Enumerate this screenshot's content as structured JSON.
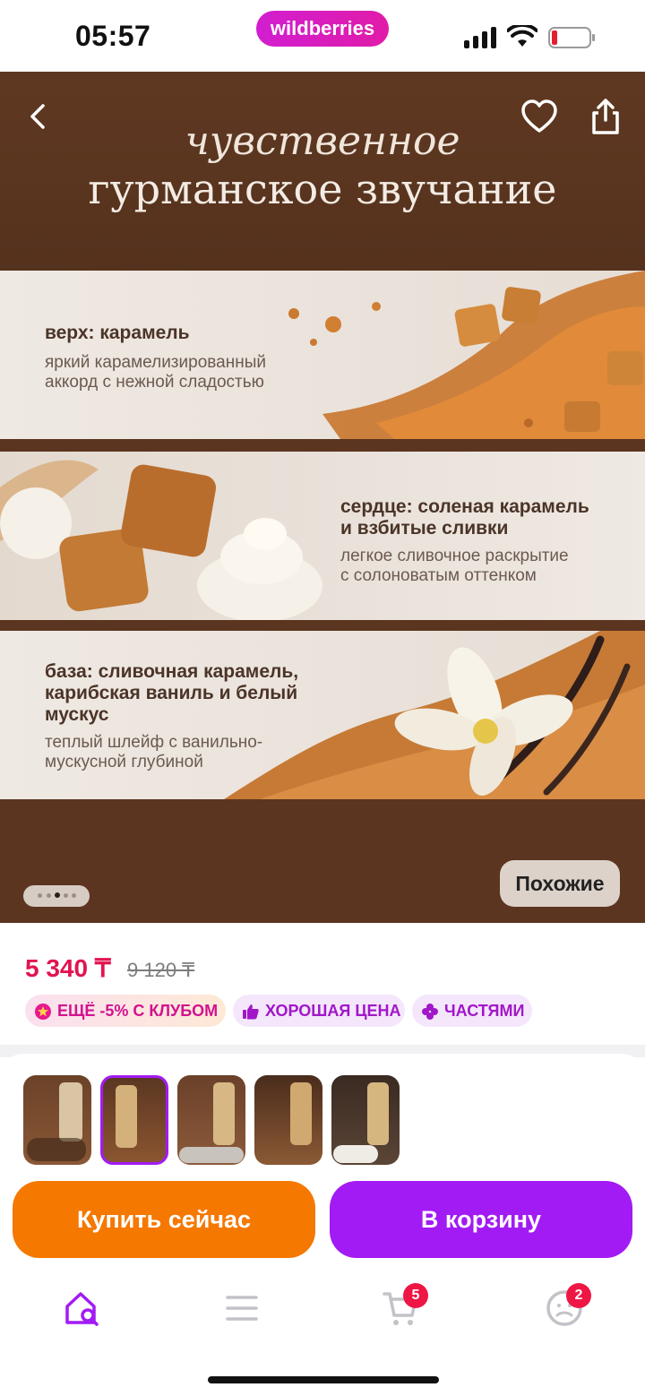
{
  "status_bar": {
    "time": "05:57",
    "app_badge": "wildberries"
  },
  "hero": {
    "headline_line1": "чувственное",
    "headline_line2": "гурманское звучание",
    "notes": [
      {
        "title": "верх: карамель",
        "text_line1": "яркий карамелизированный",
        "text_line2": "аккорд с нежной сладостью"
      },
      {
        "title_line1": "сердце: соленая карамель",
        "title_line2": "и взбитые сливки",
        "text_line1": "легкое сливочное раскрытие",
        "text_line2": "с солоноватым оттенком"
      },
      {
        "title_line1": "база: сливочная карамель,",
        "title_line2": "карибская ваниль и белый",
        "title_line3": "мускус",
        "text_line1": "теплый шлейф с ванильно-",
        "text_line2": "мускусной глубиной"
      }
    ],
    "similar_button": "Похожие"
  },
  "product": {
    "price": "5 340 ₸",
    "old_price": "9 120 ₸",
    "chips": {
      "club": "ЕЩЁ -5% С КЛУБОМ",
      "good_price": "ХОРОШАЯ ЦЕНА",
      "installments": "ЧАСТЯМИ"
    }
  },
  "actions": {
    "buy_now": "Купить сейчас",
    "add_to_cart": "В корзину"
  },
  "tabbar": {
    "cart_count": "5",
    "profile_count": "2"
  },
  "colors": {
    "brand": "#cb11ab",
    "price": "#e2134f",
    "buy": "#f57800",
    "cart": "#a21bf4",
    "hero_bg": "#5b3520"
  },
  "icons": [
    "back-icon",
    "heart-icon",
    "share-icon",
    "home-search-icon",
    "menu-icon",
    "cart-icon",
    "profile-icon",
    "star-icon",
    "thumbs-up-icon",
    "clover-icon"
  ]
}
